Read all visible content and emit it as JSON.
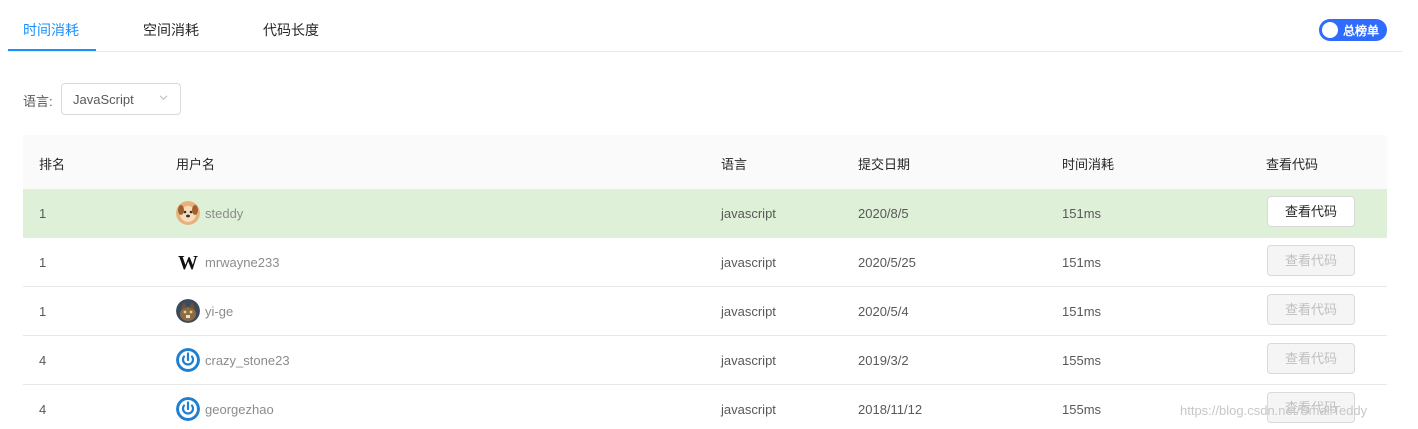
{
  "tabs": [
    {
      "label": "时间消耗",
      "active": true
    },
    {
      "label": "空间消耗",
      "active": false
    },
    {
      "label": "代码长度",
      "active": false
    }
  ],
  "toggle": {
    "label": "总榜单",
    "on": true
  },
  "filter": {
    "label": "语言:",
    "value": "JavaScript"
  },
  "table": {
    "headers": {
      "rank": "排名",
      "user": "用户名",
      "lang": "语言",
      "date": "提交日期",
      "time": "时间消耗",
      "code": "查看代码"
    },
    "rows": [
      {
        "rank": "1",
        "user": "steddy",
        "avatar": "dog-avatar",
        "lang": "javascript",
        "date": "2020/8/5",
        "time": "151ms",
        "btn": "查看代码"
      },
      {
        "rank": "1",
        "user": "mrwayne233",
        "avatar": "w-letter-avatar",
        "lang": "javascript",
        "date": "2020/5/25",
        "time": "151ms",
        "btn": "查看代码"
      },
      {
        "rank": "1",
        "user": "yi-ge",
        "avatar": "cat-photo-avatar",
        "lang": "javascript",
        "date": "2020/5/4",
        "time": "151ms",
        "btn": "查看代码"
      },
      {
        "rank": "4",
        "user": "crazy_stone23",
        "avatar": "power-icon-avatar",
        "lang": "javascript",
        "date": "2019/3/2",
        "time": "155ms",
        "btn": "查看代码"
      },
      {
        "rank": "4",
        "user": "georgezhao",
        "avatar": "power-icon-avatar",
        "lang": "javascript",
        "date": "2018/11/12",
        "time": "155ms",
        "btn": "查看代码"
      }
    ]
  },
  "colors": {
    "accent": "#1a90ff",
    "toggle": "#2f6bff",
    "highlight_row": "#dff0d8"
  },
  "watermark": "https://blog.csdn.net/SmallTeddy"
}
